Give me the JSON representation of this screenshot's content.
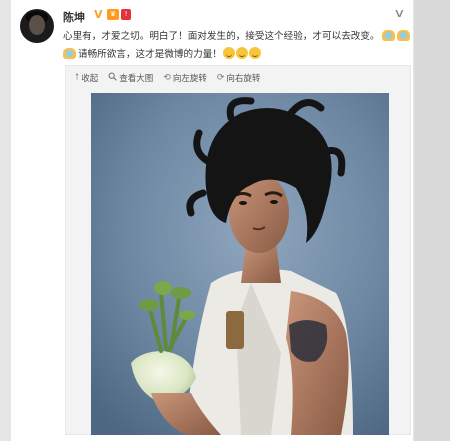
{
  "user": {
    "name": "陈坤",
    "badge_v": "V",
    "badge_crown": "♛",
    "badge_red": "!"
  },
  "post": {
    "line1": "心里有，才爱之切。明白了！面对发生的，接受这个经验，才可以去改变。",
    "line2": "请畅所欲言，这才是微博的力量！"
  },
  "toolbar": {
    "collapse_label": "收起",
    "view_large_label": "查看大图",
    "rotate_left_label": "向左旋转",
    "rotate_right_label": "向右旋转"
  },
  "icons": {
    "collapse": "arrow-up-icon",
    "view_large": "magnifier-icon",
    "rotate_left": "rotate-left-icon",
    "rotate_right": "rotate-right-icon",
    "menu": "chevron-down-icon"
  },
  "colors": {
    "text": "#333333",
    "toolbar_text": "#555555",
    "badge_v": "#f5a623",
    "badge_red": "#e6303b"
  }
}
